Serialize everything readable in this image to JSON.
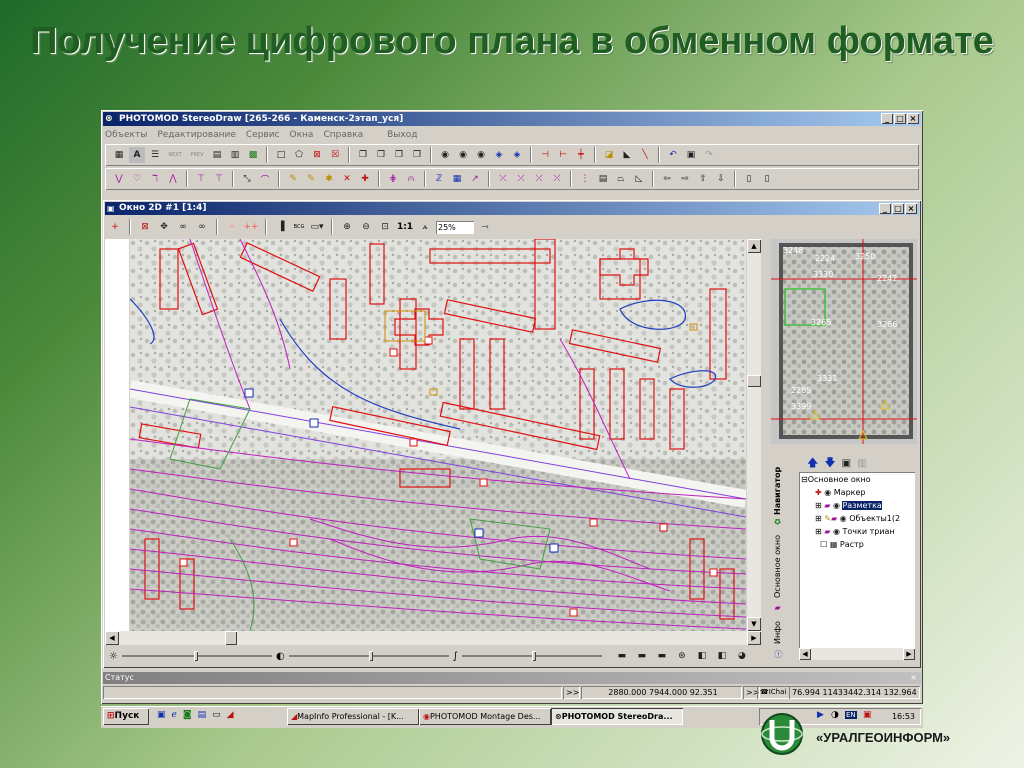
{
  "slide": {
    "title": "Получение цифрового плана в обменном формате",
    "company": "«УРАЛГЕОИНФОРМ»"
  },
  "app": {
    "title": "PHOTOMOD StereoDraw [265-266 - Каменск-2этап_уся]",
    "menu": [
      "Объекты",
      "Редактирование",
      "Сервис",
      "Окна",
      "Справка",
      "Выход"
    ],
    "toolbar_text": {
      "next": "NEXT",
      "prev": "PREV"
    }
  },
  "child_window": {
    "title": "Окно 2D #1 [1:4]",
    "scale_label": "1:1",
    "zoom_value": "25%",
    "bcg_label": "BCG"
  },
  "overview": {
    "labels": [
      "3248",
      "2224",
      "3250",
      "3330",
      "2242",
      "3265",
      "3266",
      "3331",
      "2285",
      "3399"
    ]
  },
  "nav": {
    "tabs": [
      "Навигатор",
      "Основное окно",
      "Инфо"
    ],
    "tree": {
      "root": "Основное окно",
      "items": [
        {
          "label": "Маркер",
          "selected": false
        },
        {
          "label": "Разметка",
          "selected": true
        },
        {
          "label": "Объекты1(2",
          "selected": false
        },
        {
          "label": "Точки триан",
          "selected": false
        },
        {
          "label": "Растр",
          "selected": false
        }
      ]
    }
  },
  "status": {
    "title": "Статус",
    "chevrons": ">>",
    "coords": "2880.000 7944.000 92.351",
    "chevrons2": ">>",
    "mode": "IChai",
    "coords2": "76.994 11433442.314 132.964"
  },
  "taskbar": {
    "start": "Пуск",
    "tasks": [
      "MapInfo Professional - [K...",
      "PHOTOMOD Montage Des...",
      "PHOTOMOD StereoDra..."
    ],
    "clock": "16:53",
    "lang": "EN"
  },
  "colors": {
    "title_green": "#1f5d22",
    "building": "#e01010",
    "contour": "#c020c0",
    "road": "#8040e0",
    "water": "#2040c0",
    "vegetation": "#40a040",
    "selection": "#0a246a"
  }
}
